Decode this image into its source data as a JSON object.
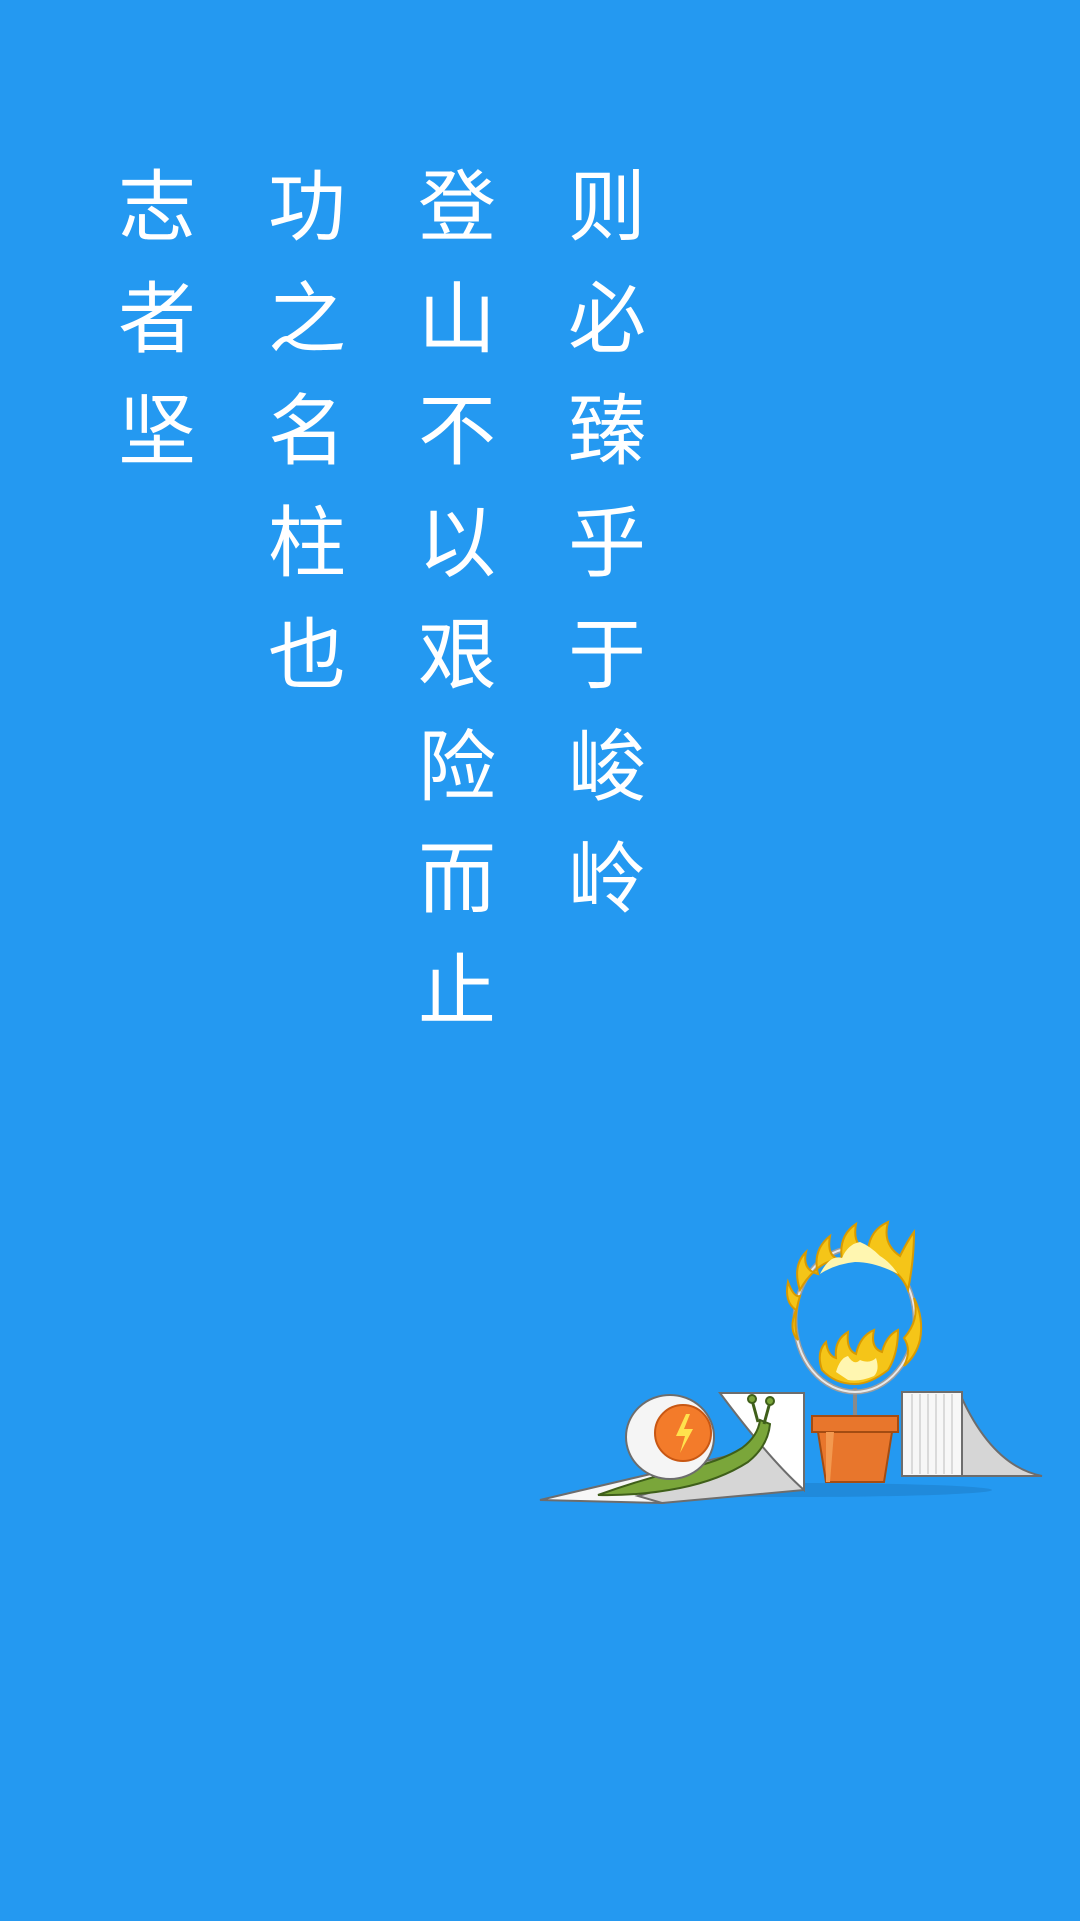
{
  "background_color": "#2499F1",
  "text_color": "#FFFFFF",
  "poem": {
    "columns": [
      {
        "chars": [
          "志",
          "者",
          "坚"
        ]
      },
      {
        "chars": [
          "功",
          "之",
          "名",
          "柱",
          "也"
        ]
      },
      {
        "chars": [
          "登",
          "山",
          "不",
          "以",
          "艰",
          "险",
          "而",
          "止"
        ]
      },
      {
        "chars": [
          "则",
          "必",
          "臻",
          "乎",
          "于",
          "峻",
          "岭"
        ]
      }
    ]
  },
  "illustration": {
    "subject": "snail-on-ramp-jumping-through-fire-ring",
    "icon": "lightning-bolt-icon",
    "colors": {
      "snail_body": "#7AA63A",
      "shell": "#F5F5F5",
      "shell_badge": "#F37B2A",
      "pot": "#E8762C",
      "flame_outer": "#F5C518",
      "flame_inner": "#FFF6B0",
      "ramp": "#F7F7F7"
    }
  }
}
